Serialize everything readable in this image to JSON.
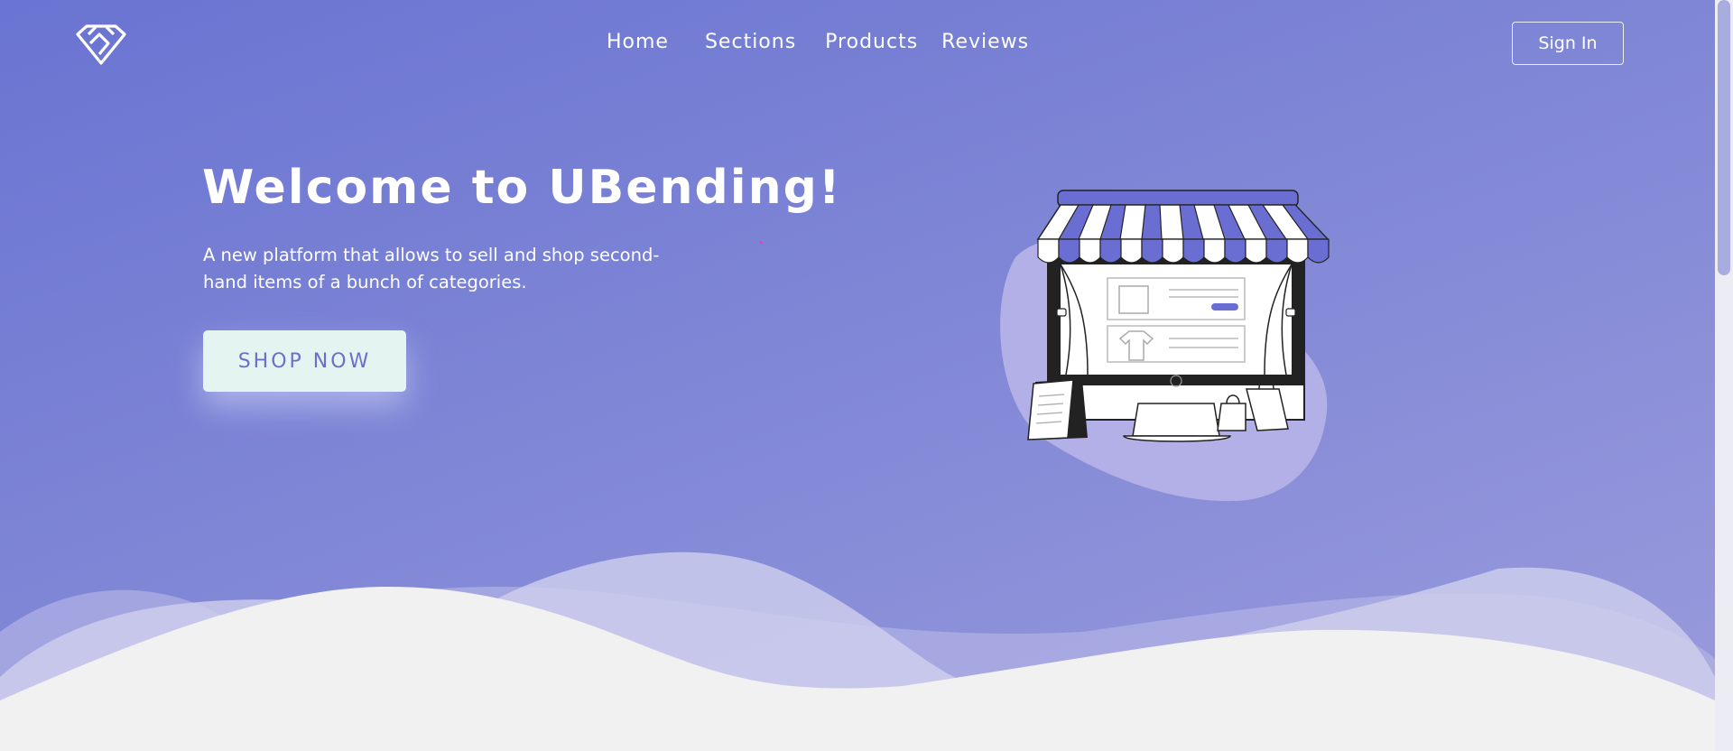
{
  "brand": {
    "logo_icon": "diamond-logo-icon"
  },
  "nav": {
    "items": [
      {
        "label": "Home"
      },
      {
        "label": "Sections"
      },
      {
        "label": "Products"
      },
      {
        "label": "Reviews"
      }
    ],
    "signin_label": "Sign In"
  },
  "hero": {
    "title": "Welcome to UBending!",
    "subtitle": "A new platform that allows to sell and shop second-hand items of a bunch of categories.",
    "cta_label": "SHOP NOW",
    "illustration_icon": "online-store-icon"
  },
  "colors": {
    "accent": "#6a74d2",
    "cta_bg": "#e4f4f1",
    "cta_text": "#6a70c9",
    "footer_bg": "#f1f1f1"
  }
}
